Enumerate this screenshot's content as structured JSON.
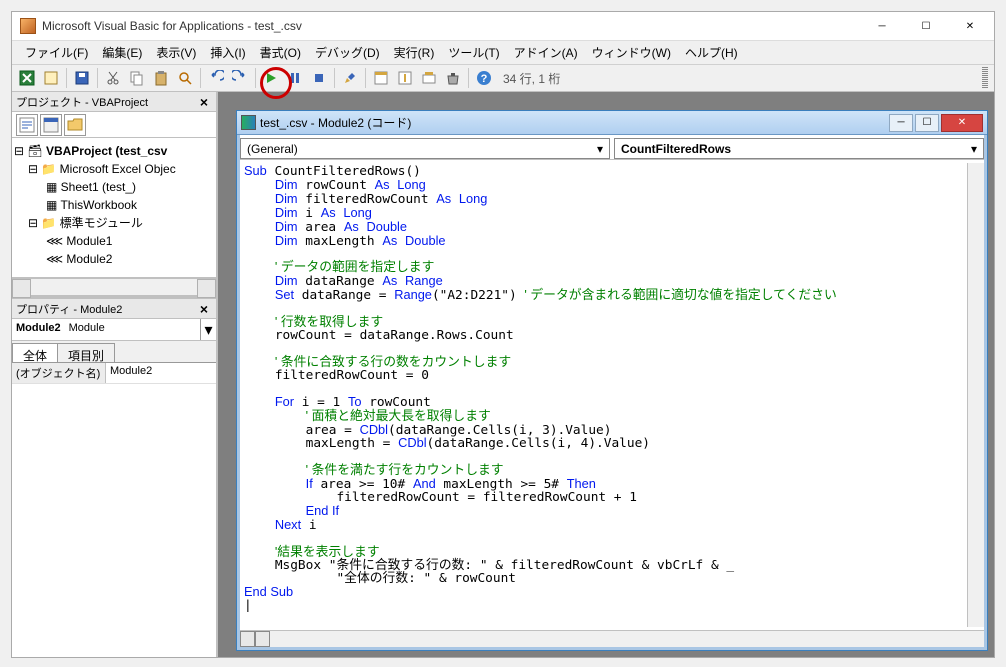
{
  "title": "Microsoft Visual Basic for Applications - test_.csv",
  "menubar": [
    "ファイル(F)",
    "編集(E)",
    "表示(V)",
    "挿入(I)",
    "書式(O)",
    "デバッグ(D)",
    "実行(R)",
    "ツール(T)",
    "アドイン(A)",
    "ウィンドウ(W)",
    "ヘルプ(H)"
  ],
  "toolbar_status": "34 行, 1 桁",
  "project_panel_title": "プロジェクト - VBAProject",
  "tree": {
    "root": "VBAProject (test_csv",
    "folder1": "Microsoft Excel Objec",
    "sheet": "Sheet1 (test_)",
    "thiswb": "ThisWorkbook",
    "folder2": "標準モジュール",
    "mod1": "Module1",
    "mod2": "Module2"
  },
  "properties_panel_title": "プロパティ - Module2",
  "properties": {
    "selector_bold": "Module2",
    "selector_type": "Module",
    "tab_all": "全体",
    "tab_by": "項目別",
    "row_name": "(オブジェクト名)",
    "row_val": "Module2"
  },
  "code_window": {
    "title": "test_.csv - Module2 (コード)",
    "dd_left": "(General)",
    "dd_right": "CountFilteredRows"
  },
  "code": "Sub CountFilteredRows()\n    Dim rowCount As Long\n    Dim filteredRowCount As Long\n    Dim i As Long\n    Dim area As Double\n    Dim maxLength As Double\n    \n    ' データの範囲を指定します\n    Dim dataRange As Range\n    Set dataRange = Range(\"A2:D221\") ' データが含まれる範囲に適切な値を指定してください\n    \n    ' 行数を取得します\n    rowCount = dataRange.Rows.Count\n    \n    ' 条件に合致する行の数をカウントします\n    filteredRowCount = 0\n    \n    For i = 1 To rowCount\n        ' 面積と絶対最大長を取得します\n        area = CDbl(dataRange.Cells(i, 3).Value)\n        maxLength = CDbl(dataRange.Cells(i, 4).Value)\n        \n        ' 条件を満たす行をカウントします\n        If area >= 10# And maxLength >= 5# Then\n            filteredRowCount = filteredRowCount + 1\n        End If\n    Next i\n    \n    '結果を表示します\n    MsgBox \"条件に合致する行の数: \" & filteredRowCount & vbCrLf & _\n            \"全体の行数: \" & rowCount\nEnd Sub\n|"
}
